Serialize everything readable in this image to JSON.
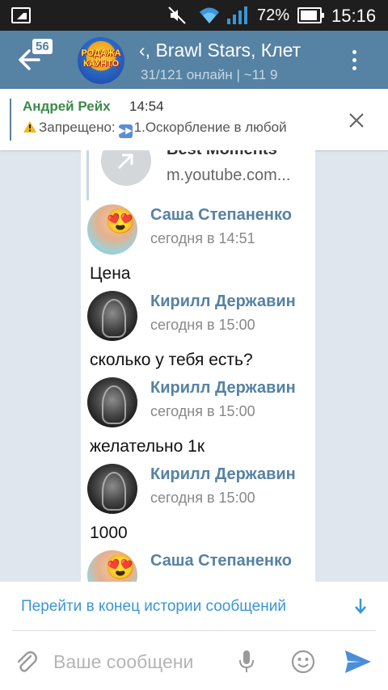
{
  "status_bar": {
    "battery": "72%",
    "time": "15:16",
    "icons": [
      "image-icon",
      "mute-icon",
      "wifi-icon",
      "signal-icon",
      "battery-icon"
    ]
  },
  "header": {
    "unread_count": "56",
    "avatar_text": "РОДАЖА\nКАУНТО",
    "title": "‹, Brawl Stars, Клет",
    "subtitle": "31/121 онлайн | ~11 9",
    "color": "#5682a3"
  },
  "pinned": {
    "author": "Андрей Рейх",
    "time": "14:54",
    "text_prefix": "Запрещено:",
    "text_rest": "1.Оскорбление в любой"
  },
  "link_preview": {
    "title": "Best Moments",
    "url": "m.youtube.com..."
  },
  "messages": [
    {
      "author": "Саша Степаненко",
      "time": "сегодня в 14:51",
      "text": "Цена",
      "avatar": "sasha"
    },
    {
      "author": "Кирилл Державин",
      "time": "сегодня в 15:00",
      "text": "сколько у тебя есть?",
      "avatar": "kirill"
    },
    {
      "author": "Кирилл Державин",
      "time": "сегодня в 15:00",
      "text": "желательно 1к",
      "avatar": "kirill"
    },
    {
      "author": "Кирилл Державин",
      "time": "сегодня в 15:00",
      "text": "1000",
      "avatar": "kirill"
    },
    {
      "author": "Саша Степаненко",
      "time": "",
      "text": "",
      "avatar": "sasha"
    }
  ],
  "jump_bar": {
    "label": "Перейти в конец истории сообщений"
  },
  "composer": {
    "placeholder": "Ваше сообщени"
  },
  "colors": {
    "accent": "#5682a3",
    "link": "#3b95d6",
    "pinned_author": "#3a8a4a",
    "background": "#dfe6ed"
  }
}
